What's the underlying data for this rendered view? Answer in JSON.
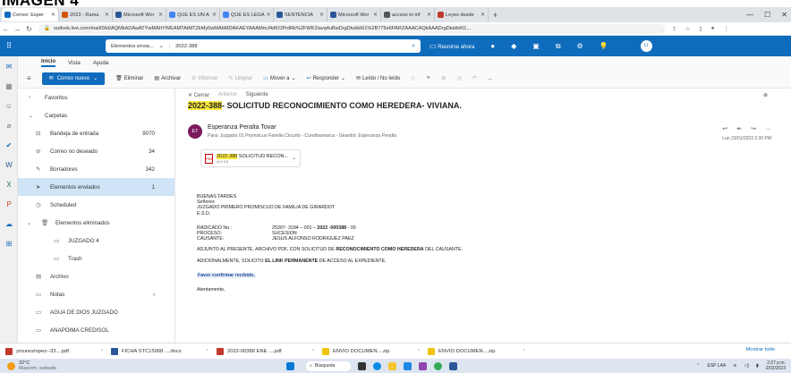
{
  "caption": "IMAGEN 4",
  "browser": {
    "tabs": [
      {
        "label": "Correo: Esper",
        "color": "#0f6cbd",
        "active": true
      },
      {
        "label": "2023 - Rama",
        "color": "#d35400"
      },
      {
        "label": "Microsoft Wor",
        "color": "#2b579a"
      },
      {
        "label": "QUE ES UN A",
        "color": "#4285f4"
      },
      {
        "label": "QUE ES LEGA",
        "color": "#4285f4"
      },
      {
        "label": "SENTENCIA",
        "color": "#2b579a"
      },
      {
        "label": "Microsoft Wor",
        "color": "#2b579a"
      },
      {
        "label": "acceso to inf",
        "color": "#555"
      },
      {
        "label": "Leyes desde",
        "color": "#c0392b"
      }
    ],
    "new_tab": "+",
    "url": "outlook.live.com/mail/0/id/AQMkADAwATYwMAItYWEAMTAtMTZkMy0wMAItMDAKAEYAAAMmJ4dKOPrdRk%2FWK2lavq4uBwDrgDtukbKl1%2B775e6PARZAAACAQkAAADrgDtukbKl1..."
  },
  "owa": {
    "search_scope": "Elementos envia...",
    "search_query": "2022-388",
    "meet_now": "Reunirse ahora",
    "user_initials": "LI"
  },
  "ribbon": {
    "tabs": [
      "Inicio",
      "Vista",
      "Ayuda"
    ],
    "new_mail": "Correo nuevo",
    "delete": "Eliminar",
    "archive": "Archivar",
    "report": "Informar",
    "sweep": "Limpiar",
    "move_to": "Mover a",
    "reply": "Responder",
    "read_unread": "Leído / No leído",
    "more": "..."
  },
  "folders": {
    "favorites": "Favoritos",
    "folders_header": "Carpetas",
    "items": [
      {
        "label": "Bandeja de entrada",
        "count": "9070",
        "icon": "inbox-icon",
        "glyph": "⊟"
      },
      {
        "label": "Correo no deseado",
        "count": "34",
        "icon": "junk-icon",
        "glyph": "⊘"
      },
      {
        "label": "Borradores",
        "count": "342",
        "icon": "draft-icon",
        "glyph": "✎"
      },
      {
        "label": "Elementos enviados",
        "count": "1",
        "icon": "sent-icon",
        "glyph": "➤",
        "selected": true
      },
      {
        "label": "Scheduled",
        "count": "",
        "icon": "clock-icon",
        "glyph": "◷"
      }
    ],
    "deleted": "Elementos eliminados",
    "sub_items": [
      {
        "label": "JUZGADO 4",
        "icon": "folder-icon"
      },
      {
        "label": "Trash",
        "icon": "folder-icon"
      }
    ],
    "items2": [
      {
        "label": "Archivo",
        "icon": "archive-icon",
        "glyph": "▤"
      },
      {
        "label": "Notas",
        "icon": "notes-icon",
        "glyph": "▭"
      },
      {
        "label": "AGUA DE DIOS JUZGADO",
        "icon": "folder-icon",
        "glyph": "▭"
      },
      {
        "label": "ANAPOIMA CREDISOL",
        "icon": "folder-icon",
        "glyph": "▭"
      }
    ]
  },
  "message": {
    "close": "Cerrar",
    "previous": "Anterior",
    "next": "Siguiente",
    "subject_highlight": "2022-388",
    "subject_rest": "- SOLICITUD RECONOCIMIENTO COMO HEREDERA- VIVIANA.",
    "sender_initials": "ET",
    "sender_name": "Esperanza Peralta Tovar",
    "to": "Para: Juzgado 01 Promiscuo Familia Circuito - Cundinamarca - Girardot; Esperanza Peralta",
    "date": "Lun 23/01/2023 2:30 PM",
    "attachment_highlight": "2022-388",
    "attachment_name": "SOLICITUD RECON...",
    "attachment_size": "849 KB",
    "body": {
      "greeting": "BUENAS TARDES",
      "line1": "Señores",
      "line2": "JUZGADO PRIMERO PROMISCUO DE FAMILIA DE GIRARDOT",
      "line3": "E.S.D.",
      "rad_label": "RADICADO No.:",
      "rad_value_a": "25307- 3184 – 001 –",
      "rad_value_b": "2022 -000388",
      "rad_value_c": "- 00",
      "proc_label": "PROCESO:",
      "proc_value": "SUCESION",
      "caus_label": "CAUSANTE:",
      "caus_value": "JESUS ALFONSO RODRIGUEZ PAEZ",
      "p1_a": "ADJUNTO AL PRESENTE, ARCHIVO PDF, CON SOLICITUD DE",
      "p1_b": "RECONOCIMIENTO COMO HEREDERA",
      "p1_c": "DEL CAUSANTE.",
      "p2_a": "ADICIONALMENTE, SOLICITO",
      "p2_b": "EL LINK PERMANENTE",
      "p2_c": "DE ACCESO AL EXPEDIENTE.",
      "confirm": "Favor confirmar recibido.",
      "closing": "Atentamente,"
    }
  },
  "downloads": [
    {
      "label": "ymunozlopez--33....pdf",
      "color": "#c0392b"
    },
    {
      "label": "FICHA STC15068 ....docx",
      "color": "#2b579a"
    },
    {
      "label": "2022-00388 ENE ....pdf",
      "color": "#c0392b"
    },
    {
      "label": "ENVIO DOCUMEN....zip",
      "color": "#f1c40f"
    },
    {
      "label": "ENVIO DOCUMEN....zip",
      "color": "#f1c40f"
    }
  ],
  "show_all": "Mostrar todo",
  "taskbar": {
    "temp": "32°C",
    "weather": "Mayorm. soleado",
    "search": "Búsqueda",
    "lang": "ESP LAA",
    "time": "2:27 p.m.",
    "date": "2/02/2023"
  }
}
